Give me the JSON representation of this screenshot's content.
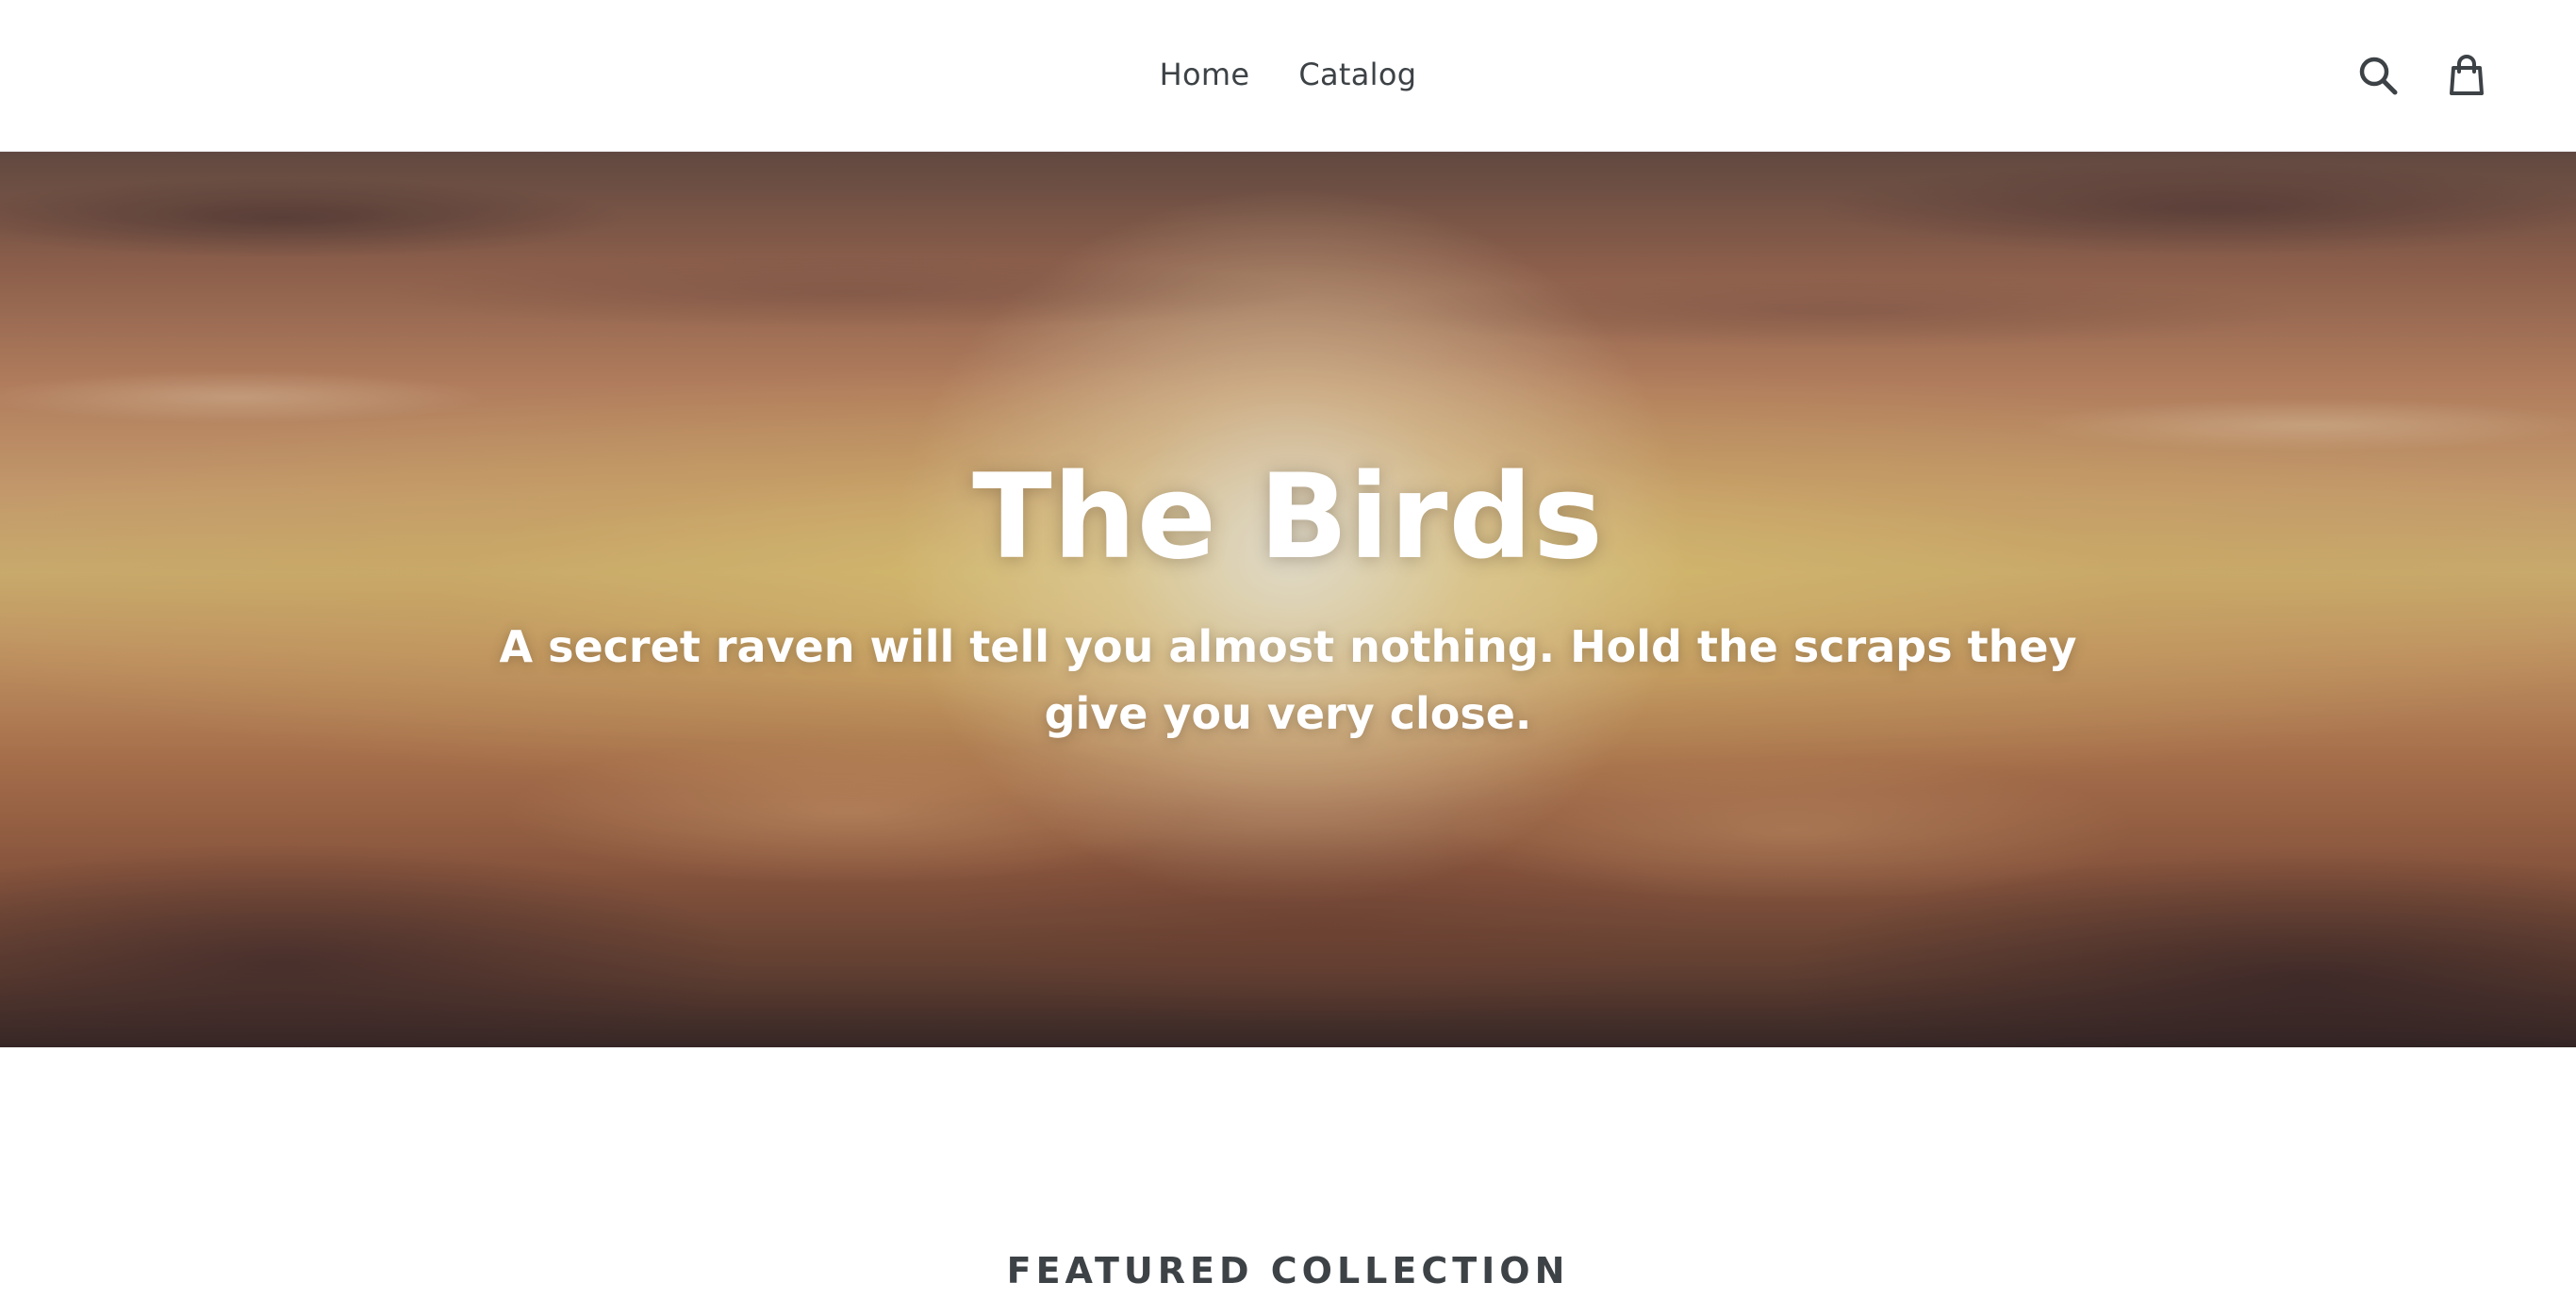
{
  "header": {
    "nav": [
      {
        "label": "Home"
      },
      {
        "label": "Catalog"
      }
    ],
    "icons": {
      "search": "search-icon",
      "cart": "cart-icon"
    }
  },
  "hero": {
    "title": "The Birds",
    "subtitle": "A secret raven will tell you almost nothing. Hold the scraps they give you very close."
  },
  "featured": {
    "heading": "FEATURED COLLECTION"
  },
  "colors": {
    "text": "#3d4246",
    "background": "#ffffff"
  }
}
